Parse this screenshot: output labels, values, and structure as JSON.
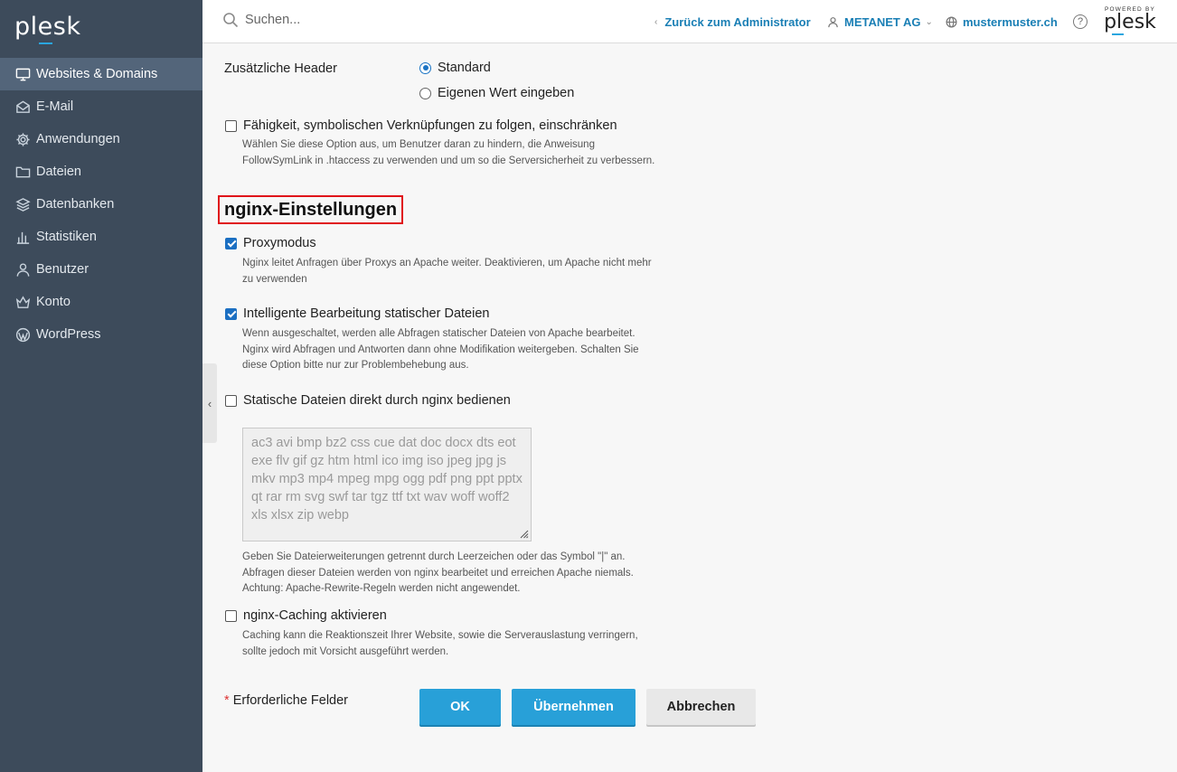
{
  "app": {
    "logo_text_a": "pl",
    "logo_text_e": "e",
    "logo_text_b": "sk",
    "powered_by": "POWERED BY",
    "powered_logo": "plesk"
  },
  "sidebar": {
    "items": [
      {
        "label": "Websites & Domains",
        "icon": "monitor-icon",
        "active": true
      },
      {
        "label": "E-Mail",
        "icon": "envelope-icon",
        "active": false
      },
      {
        "label": "Anwendungen",
        "icon": "gear-icon",
        "active": false
      },
      {
        "label": "Dateien",
        "icon": "folder-icon",
        "active": false
      },
      {
        "label": "Datenbanken",
        "icon": "layers-icon",
        "active": false
      },
      {
        "label": "Statistiken",
        "icon": "bar-chart-icon",
        "active": false
      },
      {
        "label": "Benutzer",
        "icon": "user-icon",
        "active": false
      },
      {
        "label": "Konto",
        "icon": "crown-icon",
        "active": false
      },
      {
        "label": "WordPress",
        "icon": "wordpress-icon",
        "active": false
      }
    ],
    "collapse_glyph": "‹"
  },
  "header": {
    "search_placeholder": "Suchen...",
    "back_link": "Zurück zum Administrator",
    "account": "METANET AG",
    "domain": "mustermuster.ch",
    "help": "?"
  },
  "form": {
    "additional_headers": {
      "label": "Zusätzliche Header",
      "options": [
        {
          "label": "Standard",
          "checked": true
        },
        {
          "label": "Eigenen Wert eingeben",
          "checked": false
        }
      ]
    },
    "symlinks": {
      "label": "Fähigkeit, symbolischen Verknüpfungen zu folgen, einschränken",
      "checked": false,
      "hint_1": "Wählen Sie diese Option aus, um Benutzer daran zu hindern, die Anweisung",
      "hint_2": "FollowSymLink in .htaccess zu verwenden und um so die Serversicherheit zu verbessern."
    },
    "nginx_section_title": "nginx-Einstellungen",
    "proxy_mode": {
      "label": "Proxymodus",
      "checked": true,
      "hint_1": "Nginx leitet Anfragen über Proxys an Apache weiter. Deaktivieren, um Apache nicht mehr",
      "hint_2": "zu verwenden"
    },
    "smart_static": {
      "label": "Intelligente Bearbeitung statischer Dateien",
      "checked": true,
      "hint_1": "Wenn ausgeschaltet, werden alle Abfragen statischer Dateien von Apache bearbeitet.",
      "hint_2": "Nginx wird Abfragen und Antworten dann ohne Modifikation weitergeben. Schalten Sie",
      "hint_3": "diese Option bitte nur zur Problembehebung aus."
    },
    "serve_static": {
      "label": "Statische Dateien direkt durch nginx bedienen",
      "checked": false,
      "extensions": "ac3 avi bmp bz2 css cue dat doc docx dts eot exe flv gif gz htm html ico img iso jpeg jpg js mkv mp3 mp4 mpeg mpg ogg pdf png ppt pptx qt rar rm svg swf tar tgz ttf txt wav woff woff2 xls xlsx zip webp",
      "hint_1": "Geben Sie Dateierweiterungen getrennt durch Leerzeichen oder das Symbol \"|\" an.",
      "hint_2": "Abfragen dieser Dateien werden von nginx bearbeitet und erreichen Apache niemals.",
      "hint_3": "Achtung: Apache-Rewrite-Regeln werden nicht angewendet."
    },
    "caching": {
      "label": "nginx-Caching aktivieren",
      "checked": false,
      "hint_1": "Caching kann die Reaktionszeit Ihrer Website, sowie die Serverauslastung verringern,",
      "hint_2": "sollte jedoch mit Vorsicht ausgeführt werden."
    },
    "required_star": "*",
    "required_label": "Erforderliche Felder",
    "buttons": {
      "ok": "OK",
      "apply": "Übernehmen",
      "cancel": "Abbrechen"
    }
  }
}
